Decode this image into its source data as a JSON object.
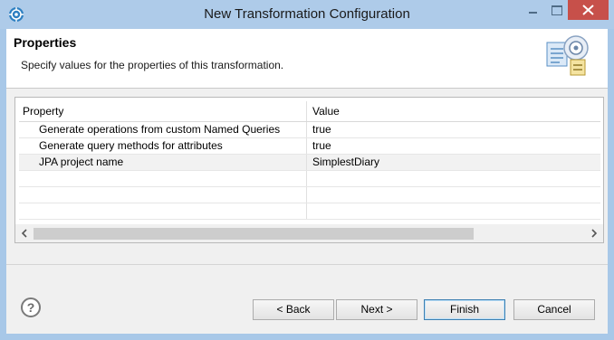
{
  "window": {
    "title": "New Transformation Configuration",
    "icon": "app-icon"
  },
  "header": {
    "title": "Properties",
    "description": "Specify values for the properties of this transformation.",
    "icon": "wizard-banner-icon"
  },
  "table": {
    "columns": [
      "Property",
      "Value"
    ],
    "rows": [
      {
        "property": "Generate operations from custom Named Queries",
        "value": "true"
      },
      {
        "property": "Generate query methods for attributes",
        "value": "true"
      },
      {
        "property": "JPA project name",
        "value": "SimplestDiary"
      }
    ]
  },
  "buttons": {
    "back": "< Back",
    "next": "Next >",
    "finish": "Finish",
    "cancel": "Cancel",
    "help": "?"
  },
  "colors": {
    "title_bar": "#aecbe9",
    "close_button": "#c7504a",
    "default_button_border": "#3c7fb1"
  }
}
